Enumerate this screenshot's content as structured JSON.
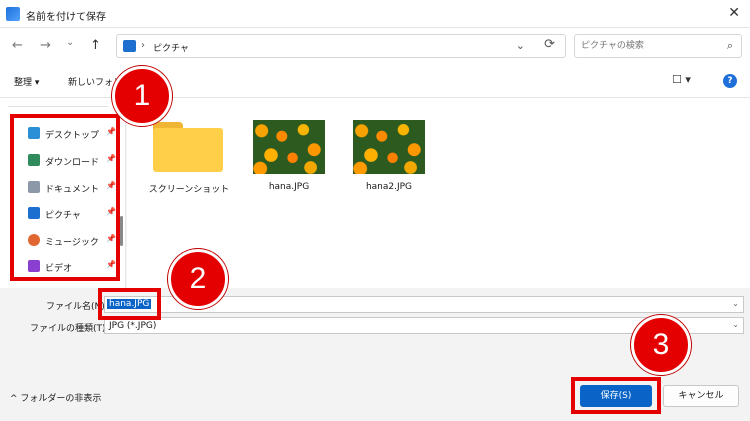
{
  "titlebar": {
    "title": "名前を付けて保存",
    "close_glyph": "✕"
  },
  "nav": {
    "back": "←",
    "forward": "→",
    "recent": "⌄",
    "up": "↑"
  },
  "address": {
    "separator": "›",
    "path": "ピクチャ",
    "dropdown": "⌄",
    "refresh": "⟳"
  },
  "search": {
    "placeholder": "ピクチャの検索",
    "icon_glyph": "⌕"
  },
  "toolbar": {
    "organize": "整理 ▾",
    "new_folder": "新しいフォルダー",
    "view": "☐ ▾",
    "help": "?"
  },
  "sidebar": {
    "items": [
      {
        "label": "デスクトップ",
        "color": "#2a8fd6"
      },
      {
        "label": "ダウンロード",
        "color": "#2f8a5c"
      },
      {
        "label": "ドキュメント",
        "color": "#8c98a8"
      },
      {
        "label": "ピクチャ",
        "color": "#1c6fce"
      },
      {
        "label": "ミュージック",
        "color": "#e0672f"
      },
      {
        "label": "ビデオ",
        "color": "#8a3fd1"
      }
    ],
    "pin_glyph": "📌"
  },
  "files": [
    {
      "name": "スクリーンショット",
      "type": "folder"
    },
    {
      "name": "hana.JPG",
      "type": "image"
    },
    {
      "name": "hana2.JPG",
      "type": "image"
    }
  ],
  "form": {
    "filename_label": "ファイル名(N):",
    "filename_value": "hana.JPG",
    "filetype_label": "ファイルの種類(T):",
    "filetype_value": "JPG (*.JPG)",
    "arrow": "⌄"
  },
  "footer": {
    "hide_folders": "^ フォルダーの非表示",
    "save": "保存(S)",
    "cancel": "キャンセル"
  },
  "markers": [
    "1",
    "2",
    "3"
  ],
  "colors": {
    "accent": "#0a64c8",
    "highlight": "#e40000"
  }
}
